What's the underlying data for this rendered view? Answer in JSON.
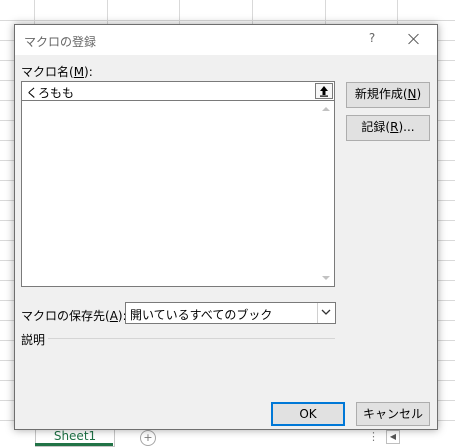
{
  "window": {
    "title": "マクロの登録"
  },
  "titlebar": {
    "help": "?",
    "close_icon": "close-icon"
  },
  "macro_name": {
    "label_pre": "マクロ名(",
    "label_key": "M",
    "label_post": "):",
    "value": "くろもも",
    "icon": "upload-arrow-icon"
  },
  "macro_list": {
    "items": []
  },
  "buttons": {
    "new_pre": "新規作成(",
    "new_key": "N",
    "new_post": ")",
    "record_pre": "記録(",
    "record_key": "R",
    "record_post": ")...",
    "ok": "OK",
    "cancel": "キャンセル"
  },
  "store": {
    "label_pre": "マクロの保存先(",
    "label_key": "A",
    "label_post": "):",
    "selected": "開いているすべてのブック"
  },
  "description": {
    "label": "説明"
  },
  "background": {
    "sheet_tab": "Sheet1",
    "add_sheet": "+",
    "dots": "⋮",
    "scroll_left": "◀"
  },
  "colors": {
    "accent": "#0078d7",
    "sheet_green": "#217346"
  }
}
